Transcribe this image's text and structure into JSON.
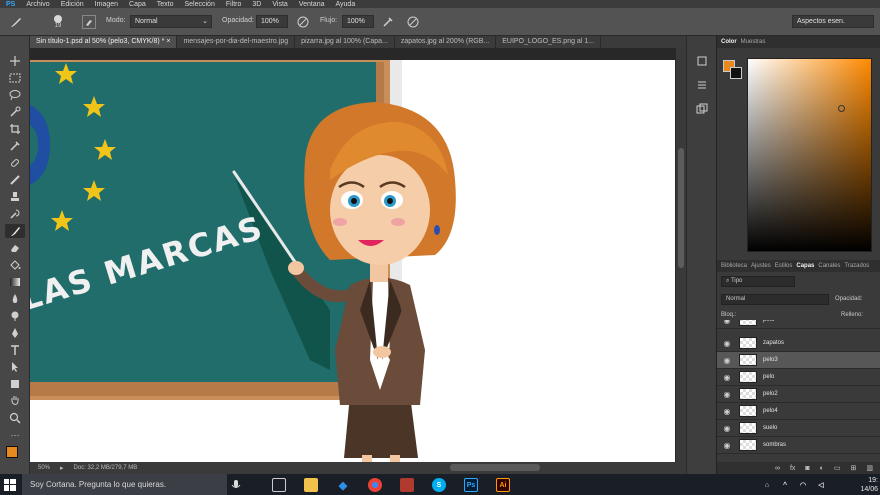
{
  "menu": {
    "app_logo": "PS",
    "items": [
      "Archivo",
      "Edición",
      "Imagen",
      "Capa",
      "Texto",
      "Selección",
      "Filtro",
      "3D",
      "Vista",
      "Ventana",
      "Ayuda"
    ]
  },
  "options_bar": {
    "brush_size": "19",
    "mode_label": "Modo:",
    "mode_value": "Normal",
    "opacity_label": "Opacidad:",
    "opacity_value": "100%",
    "flow_label": "Flujo:",
    "flow_value": "100%",
    "workspace": "Aspectos esen."
  },
  "tabs": [
    {
      "label": "Sin título-1.psd al 50% (pelo3, CMYK/8) *",
      "active": true
    },
    {
      "label": "mensajes-por-dia-del-maestro.jpg",
      "active": false
    },
    {
      "label": "pizarra.jpg al 100% (Capa...",
      "active": false
    },
    {
      "label": "zapatos.jpg al 200% (RGB...",
      "active": false
    },
    {
      "label": "EUIPO_LOGO_ES.png al 1...",
      "active": false
    }
  ],
  "canvas": {
    "board_text": "LAS MARCAS",
    "board_color": "#1f6a6a",
    "frame_color": "#c98f5a"
  },
  "status": {
    "zoom": "50%",
    "doc": "Doc: 32,2 MB/279,7 MB"
  },
  "color_panel": {
    "tabs": [
      "Color",
      "Muestras"
    ],
    "fg_color": "#e8891f",
    "bg_color": "#111111",
    "hue_color": "#ff8a00"
  },
  "layers_panel": {
    "tabs": [
      "Biblioteca",
      "Ajustes",
      "Estilos",
      "Capas",
      "Canales",
      "Trazados"
    ],
    "active_tab": "Capas",
    "filter_kind": "Tipo",
    "blend_mode": "Normal",
    "opacity_label": "Opacidad:",
    "opacity_value": "100%",
    "lock_label": "Bloq.:",
    "fill_label": "Relleno:",
    "fill_value": "100%",
    "layers": [
      {
        "name": "pelo",
        "selected": false
      },
      {
        "name": "zapatos",
        "selected": false
      },
      {
        "name": "pelo3",
        "selected": true
      },
      {
        "name": "pelo",
        "selected": false
      },
      {
        "name": "pelo2",
        "selected": false
      },
      {
        "name": "pelo4",
        "selected": false
      },
      {
        "name": "suelo",
        "selected": false
      },
      {
        "name": "sombras",
        "selected": false
      }
    ]
  },
  "taskbar": {
    "search_placeholder": "Soy Cortana. Pregunta lo que quieras.",
    "clock_time": "19:",
    "clock_date": "14/06"
  }
}
